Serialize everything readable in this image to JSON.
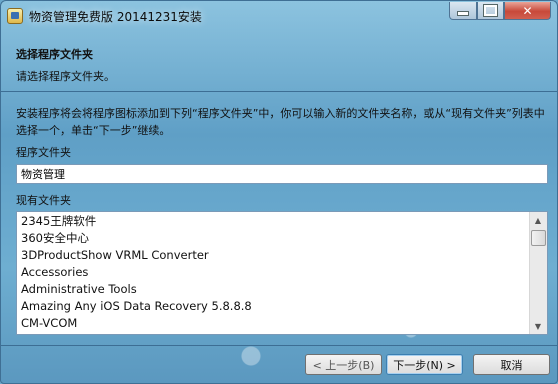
{
  "window": {
    "title": "物资管理免费版 20141231安装"
  },
  "header": {
    "title": "选择程序文件夹",
    "subtitle": "请选择程序文件夹。"
  },
  "body": {
    "description": "安装程序将会将程序图标添加到下列“程序文件夹”中，你可以输入新的文件夹名称，或从“现有文件夹”列表中选择一个，单击“下一步”继续。",
    "program_folder_label": "程序文件夹",
    "program_folder_value": "物资管理",
    "existing_folders_label": "现有文件夹",
    "existing_folders": [
      "2345王牌软件",
      "360安全中心",
      "3DProductShow VRML Converter",
      "Accessories",
      "Administrative Tools",
      "Amazing Any iOS Data Recovery 5.8.8.8",
      "CM-VCOM"
    ]
  },
  "buttons": {
    "back": "< 上一步(B)",
    "next": "下一步(N) >",
    "cancel": "取消"
  },
  "icons": {
    "app": "installer-app-icon",
    "minimize": "minimize-icon",
    "maximize": "maximize-icon",
    "close": "close-icon"
  }
}
